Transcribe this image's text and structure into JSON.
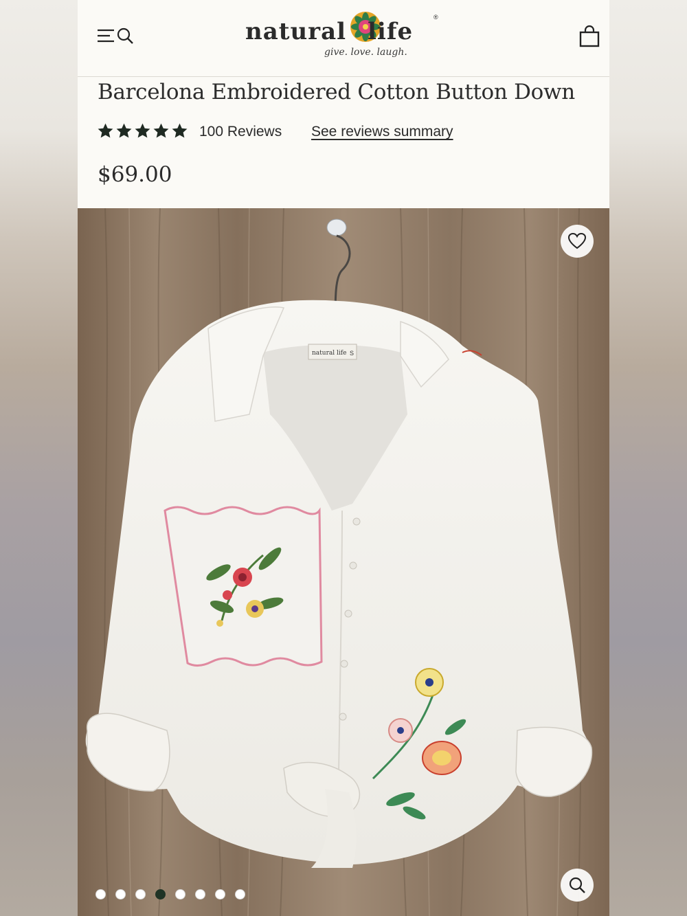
{
  "header": {
    "logo_left": "natural",
    "logo_right": "life",
    "logo_tagline": "give. love. laugh.",
    "menu_icon": "menu-icon",
    "search_icon": "search-icon",
    "cart_icon": "shopping-bag-icon"
  },
  "product": {
    "title": "Barcelona Embroidered Cotton Button Down",
    "rating": 5,
    "rating_max": 5,
    "reviews_label": "100 Reviews",
    "summary_link": "See reviews summary",
    "price": "$69.00"
  },
  "gallery": {
    "favorite_icon": "heart-icon",
    "zoom_icon": "zoom-icon",
    "image_count": 8,
    "active_index": 3,
    "tag_text": "natural life",
    "tag_size": "S"
  },
  "colors": {
    "star": "#1f2a22",
    "active_dot": "#1f3325",
    "wood": "#8b7560"
  }
}
